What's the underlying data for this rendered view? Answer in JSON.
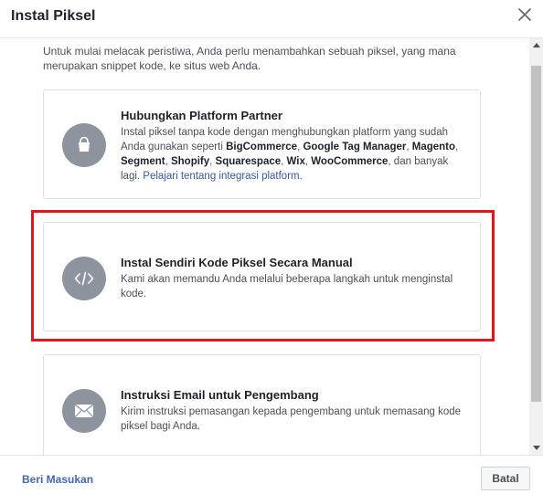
{
  "dialog": {
    "title": "Instal Piksel",
    "intro": "Untuk mulai melacak peristiwa, Anda perlu menambahkan sebuah piksel, yang mana merupakan snippet kode, ke situs web Anda."
  },
  "options": [
    {
      "icon": "shopping-bag-icon",
      "title": "Hubungkan Platform Partner",
      "desc_prefix": "Instal piksel tanpa kode dengan menghubungkan platform yang sudah Anda gunakan seperti ",
      "platforms": [
        "BigCommerce",
        "Google Tag Manager",
        "Magento",
        "Segment",
        "Shopify",
        "Squarespace",
        "Wix",
        "WooCommerce"
      ],
      "sep1": ", ",
      "sep2": ", ",
      "sep3": ", ",
      "sep4": ", ",
      "sep5": ", ",
      "sep6": ", ",
      "sep7": ", ",
      "desc_suffix": ", dan banyak lagi. ",
      "link": "Pelajari tentang integrasi platform."
    },
    {
      "icon": "code-icon",
      "title": "Instal Sendiri Kode Piksel Secara Manual",
      "desc": "Kami akan memandu Anda melalui beberapa langkah untuk menginstal kode."
    },
    {
      "icon": "envelope-icon",
      "title": "Instruksi Email untuk Pengembang",
      "desc": "Kirim instruksi pemasangan kepada pengembang untuk memasang kode piksel bagi Anda."
    }
  ],
  "footer": {
    "feedback": "Beri Masukan",
    "cancel": "Batal"
  },
  "colors": {
    "highlight": "#e0161b",
    "link": "#365899",
    "icon_bg": "#8d949e"
  }
}
